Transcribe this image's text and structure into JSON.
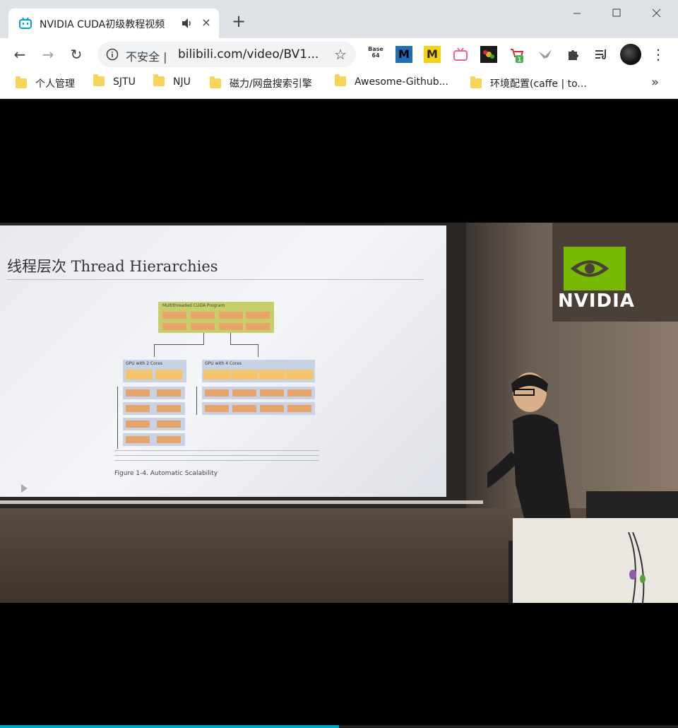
{
  "tab": {
    "title": "NVIDIA CUDA初级教程视频",
    "audio_icon": "volume-icon",
    "close": "×"
  },
  "window": {
    "minimize": "—",
    "maximize": "☐",
    "close": "✕"
  },
  "toolbar": {
    "back": "←",
    "forward": "→",
    "reload": "↻",
    "insecure_label": "不安全 |",
    "url": "bilibili.com/video/BV1...",
    "star": "☆",
    "menu": "⋮",
    "new_tab": "+",
    "extensions": [
      {
        "name": "base64-extension",
        "label": "Base 64"
      },
      {
        "name": "m-blue-extension",
        "label": "M"
      },
      {
        "name": "m-yellow-extension",
        "label": "M"
      },
      {
        "name": "tv-extension",
        "label": ""
      },
      {
        "name": "flower-extension",
        "label": ""
      },
      {
        "name": "cart-extension",
        "label": "",
        "badge": "1"
      },
      {
        "name": "bird-extension",
        "label": ""
      },
      {
        "name": "puzzle-extension",
        "label": ""
      },
      {
        "name": "reading-list-extension",
        "label": ""
      }
    ]
  },
  "bookmarks": {
    "items": [
      {
        "label": "个人管理"
      },
      {
        "label": "SJTU"
      },
      {
        "label": "NJU"
      },
      {
        "label": "磁力/网盘搜索引擎"
      },
      {
        "label": "Awesome-Github..."
      },
      {
        "label": "环境配置(caffe | to..."
      }
    ],
    "more": "»"
  },
  "video": {
    "slide_title": "线程层次 Thread Hierarchies",
    "figure_caption": "Figure 1-4.   Automatic Scalability",
    "program_box_title": "Multithreaded CUDA Program",
    "gpu2_label": "GPU with 2 Cores",
    "gpu4_label": "GPU with 4 Cores",
    "logo_text": "NVIDIA",
    "progress_fraction": 0.5,
    "colors": {
      "nvidia_green": "#76b900",
      "progress": "#00a1d6"
    }
  }
}
